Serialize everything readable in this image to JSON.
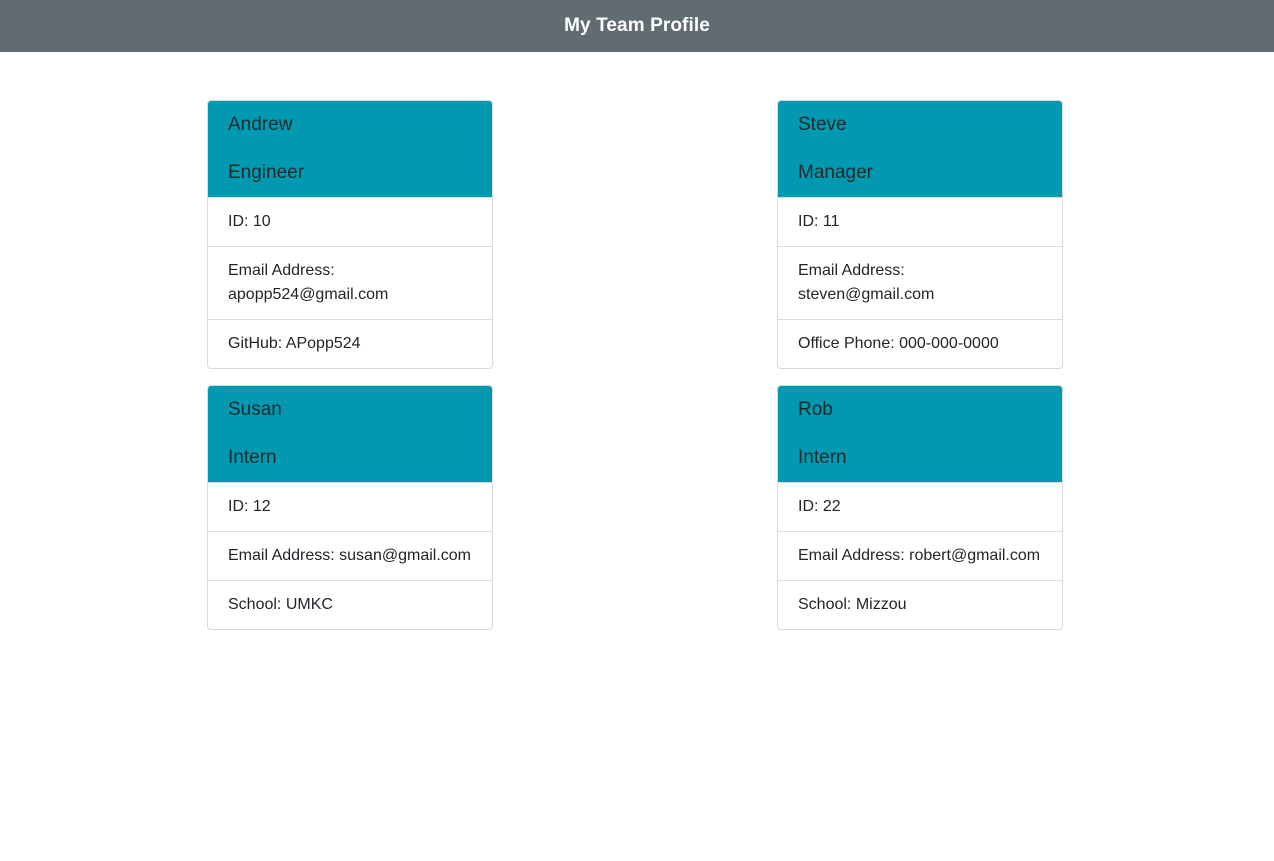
{
  "header": {
    "title": "My Team Profile"
  },
  "cards": [
    {
      "name": "Andrew",
      "role": "Engineer",
      "id_line": "ID: 10",
      "email_label": "Email Address:",
      "email": "apopp524@gmail.com",
      "extra_line": "GitHub: APopp524"
    },
    {
      "name": "Steve",
      "role": "Manager",
      "id_line": "ID: 11",
      "email_label": "Email Address:",
      "email": "steven@gmail.com",
      "extra_line": "Office Phone: 000-000-0000"
    },
    {
      "name": "Susan",
      "role": "Intern",
      "id_line": "ID: 12",
      "email_label": "Email Address:",
      "email": "susan@gmail.com",
      "extra_line": "School: UMKC"
    },
    {
      "name": "Rob",
      "role": "Intern",
      "id_line": "ID: 22",
      "email_label": "Email Address:",
      "email": "robert@gmail.com",
      "extra_line": "School: Mizzou"
    }
  ],
  "colors": {
    "navbar": "#616c72",
    "card_header": "#0099b0"
  }
}
